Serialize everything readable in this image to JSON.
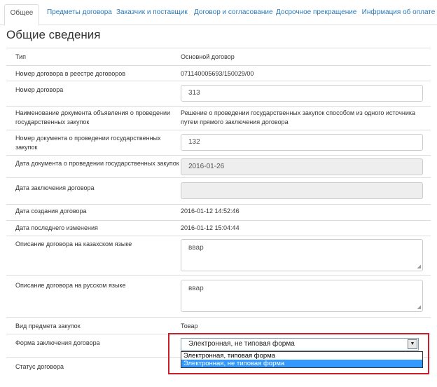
{
  "tabs": [
    {
      "label": "Общее",
      "active": true
    },
    {
      "label": "Предметы договора",
      "active": false
    },
    {
      "label": "Заказчик и поставщик",
      "active": false
    },
    {
      "label": "Договор и согласование",
      "active": false
    },
    {
      "label": "Досрочное прекращение",
      "active": false
    },
    {
      "label": "Инфрмация об оплате",
      "active": false
    }
  ],
  "page_title": "Общие сведения",
  "fields": {
    "type": {
      "label": "Тип",
      "value": "Основной договор"
    },
    "registry_number": {
      "label": "Номер договора в реестре договоров",
      "value": "071140005693/150029/00"
    },
    "contract_number": {
      "label": "Номер договора",
      "value": "313"
    },
    "announcement_doc_name": {
      "label_line1": "Наименование документа объявления о проведении",
      "label_line2": "государственных закупок",
      "value_line1": "Решение о проведении государственных закупок способом из одного источника",
      "value_line2": "путем прямого заключения договора"
    },
    "procurement_doc_number": {
      "label_line1": "Номер документа о проведении государственных",
      "label_line2": "закупок",
      "value": "132"
    },
    "procurement_doc_date": {
      "label": "Дата документа о проведении государственных закупок",
      "value": "2016-01-26"
    },
    "conclusion_date": {
      "label": "Дата заключения договора",
      "value": ""
    },
    "creation_date": {
      "label": "Дата создания договора",
      "value": "2016-01-12 14:52:46"
    },
    "last_modified": {
      "label": "Дата последнего изменения",
      "value": "2016-01-12 15:04:44"
    },
    "description_kz": {
      "label": "Описание договора на казахском языке",
      "value": "ввар"
    },
    "description_ru": {
      "label": "Описание договора на русском языке",
      "value": "ввар"
    },
    "subject_type": {
      "label": "Вид предмета закупок",
      "value": "Товар"
    },
    "conclusion_form": {
      "label": "Форма заключения договора",
      "selected": "Электронная, не типовая форма",
      "options": [
        "Электронная, типовая форма",
        "Электронная, не типовая форма"
      ]
    },
    "status": {
      "label": "Статус договора"
    }
  },
  "colors": {
    "accent": "#2a7ab8",
    "highlight_border": "#c8202a",
    "option_selected": "#3399ff"
  },
  "icons": {
    "select_arrow": "chevron-down-icon",
    "resize_grip": "resize-grip-icon"
  }
}
